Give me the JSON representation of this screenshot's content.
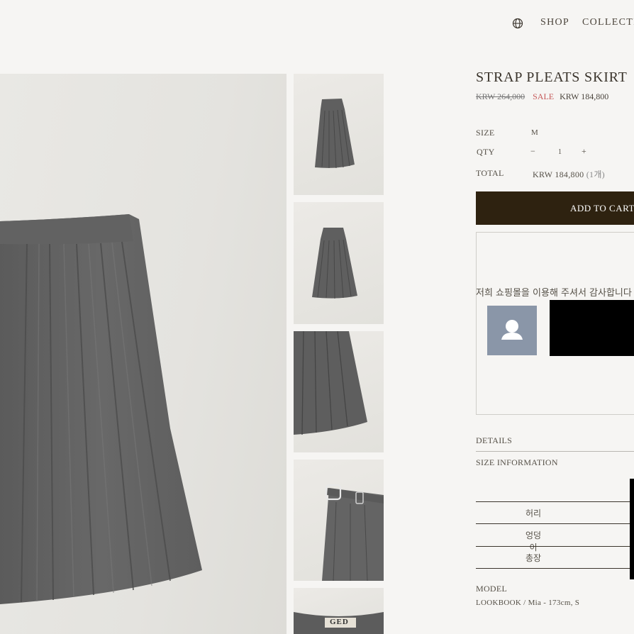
{
  "nav": {
    "shop": "SHOP",
    "collection": "COLLECTI"
  },
  "product": {
    "name": "STRAP PLEATS SKIRT",
    "original_price": "KRW 264,000",
    "sale_label": "SALE",
    "sale_price": "KRW 184,800"
  },
  "options": {
    "size_label": "SIZE",
    "size_value": "M",
    "qty_label": "QTY",
    "qty_value": "1",
    "minus": "−",
    "plus": "+",
    "total_label": "TOTAL",
    "total_value": "KRW 184,800",
    "total_count": "(1개)"
  },
  "cart": {
    "button_label": "ADD TO CART"
  },
  "review": {
    "message": "저희 쇼핑몰을 이용해 주셔서 감사합니다"
  },
  "sections": {
    "details": "DETAILS",
    "size_information": "SIZE INFORMATION"
  },
  "size_table": {
    "rows": [
      "허리",
      "엉덩이",
      "총장"
    ]
  },
  "model": {
    "label": "MODEL",
    "value": "LOOKBOOK / Mia - 173cm, S"
  },
  "thumb_label": "GED",
  "colors": {
    "cart_button": "#2e2210",
    "sale": "#c65b5b",
    "avatar": "#8a96a8"
  },
  "icons": {
    "globe": "globe-icon",
    "avatar": "user-icon"
  }
}
